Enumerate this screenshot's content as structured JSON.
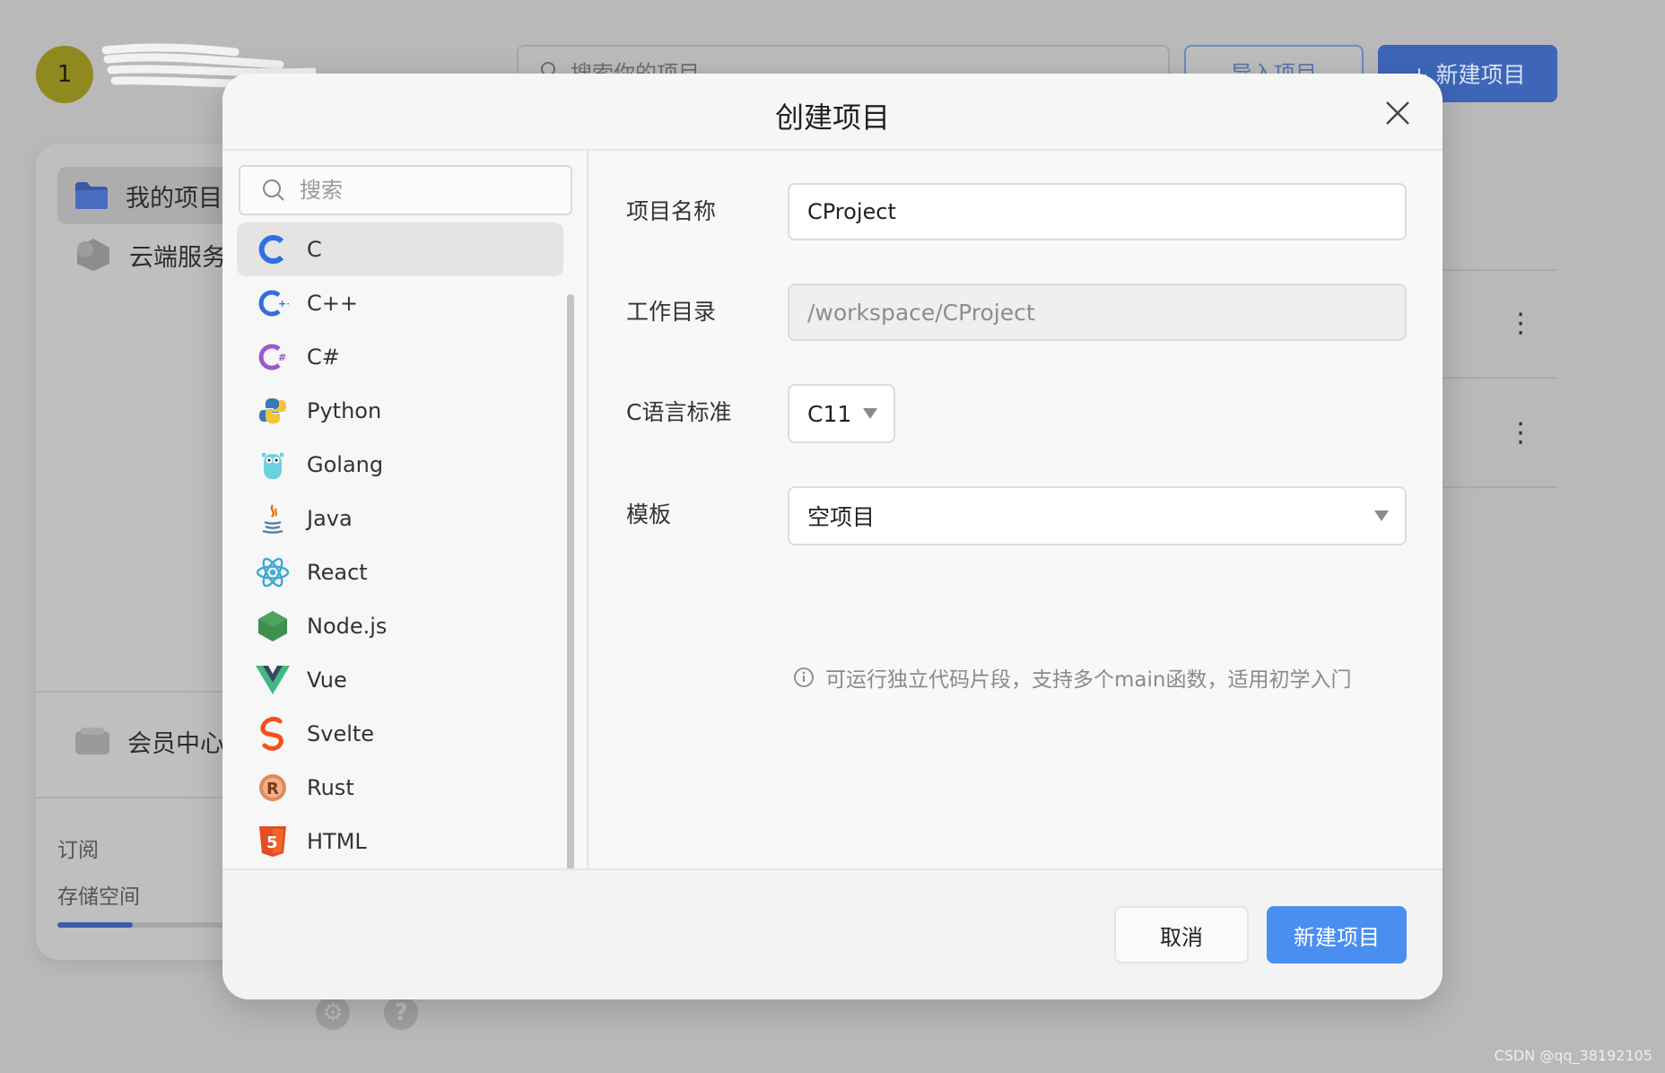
{
  "background": {
    "avatar_initial": "1",
    "search_placeholder": "搜索你的项目",
    "import_label": "导入项目",
    "new_project_label": "+ 新建项目",
    "sidebar": {
      "items": [
        {
          "label": "我的项目",
          "icon": "folder-icon",
          "active": true
        },
        {
          "label": "云端服务",
          "icon": "cloud-service-icon",
          "active": false
        }
      ],
      "member_label": "会员中心",
      "subscription_label": "订阅",
      "storage_label": "存储空间",
      "storage_progress": 0.44
    }
  },
  "modal": {
    "title": "创建项目",
    "search_placeholder": "搜索",
    "languages": [
      {
        "name": "C",
        "icon": "c-lang-icon",
        "selected": true
      },
      {
        "name": "C++",
        "icon": "cpp-lang-icon",
        "selected": false
      },
      {
        "name": "C#",
        "icon": "csharp-lang-icon",
        "selected": false
      },
      {
        "name": "Python",
        "icon": "python-icon",
        "selected": false
      },
      {
        "name": "Golang",
        "icon": "golang-gopher-icon",
        "selected": false
      },
      {
        "name": "Java",
        "icon": "java-coffee-icon",
        "selected": false
      },
      {
        "name": "React",
        "icon": "react-atom-icon",
        "selected": false
      },
      {
        "name": "Node.js",
        "icon": "nodejs-hexagon-icon",
        "selected": false
      },
      {
        "name": "Vue",
        "icon": "vue-icon",
        "selected": false
      },
      {
        "name": "Svelte",
        "icon": "svelte-icon",
        "selected": false
      },
      {
        "name": "Rust",
        "icon": "rust-gear-icon",
        "selected": false
      },
      {
        "name": "HTML",
        "icon": "html5-shield-icon",
        "selected": false
      }
    ],
    "form": {
      "name_label": "项目名称",
      "name_value": "CProject",
      "dir_label": "工作目录",
      "dir_value": "/workspace/CProject",
      "std_label": "C语言标准",
      "std_value": "C11",
      "template_label": "模板",
      "template_value": "空项目",
      "hint": "可运行独立代码片段，支持多个main函数，适用初学入门"
    },
    "cancel_label": "取消",
    "confirm_label": "新建项目"
  },
  "watermark": "CSDN @qq_38192105",
  "colors": {
    "primary": "#4a8ff0",
    "c_blue": "#2f6fe0",
    "csharp_purple": "#9b59d0"
  }
}
